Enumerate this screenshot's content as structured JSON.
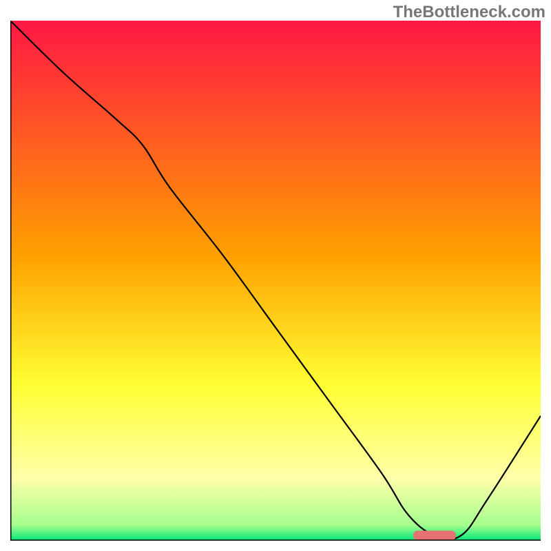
{
  "watermark": "TheBottleneck.com",
  "chart_data": {
    "type": "line",
    "title": "",
    "xlabel": "",
    "ylabel": "",
    "xlim": [
      0,
      100
    ],
    "ylim": [
      0,
      100
    ],
    "x": [
      0,
      10,
      20,
      25,
      30,
      40,
      50,
      60,
      70,
      75,
      80,
      85,
      90,
      100
    ],
    "values": [
      100,
      90,
      81,
      76,
      68,
      55,
      41,
      27,
      13,
      5,
      1,
      1,
      8,
      24
    ],
    "marker": {
      "x_start": 76,
      "x_end": 84,
      "y": 1,
      "color": "#e57373"
    },
    "gradient_stops": [
      {
        "offset": 0.0,
        "color": "#ff1744"
      },
      {
        "offset": 0.45,
        "color": "#ffa000"
      },
      {
        "offset": 0.7,
        "color": "#ffff33"
      },
      {
        "offset": 0.88,
        "color": "#ffffaa"
      },
      {
        "offset": 0.97,
        "color": "#a6ff8f"
      },
      {
        "offset": 1.0,
        "color": "#00e676"
      }
    ],
    "axes": {
      "x_visible": true,
      "y_visible": true,
      "grid": false
    },
    "legend": false
  }
}
